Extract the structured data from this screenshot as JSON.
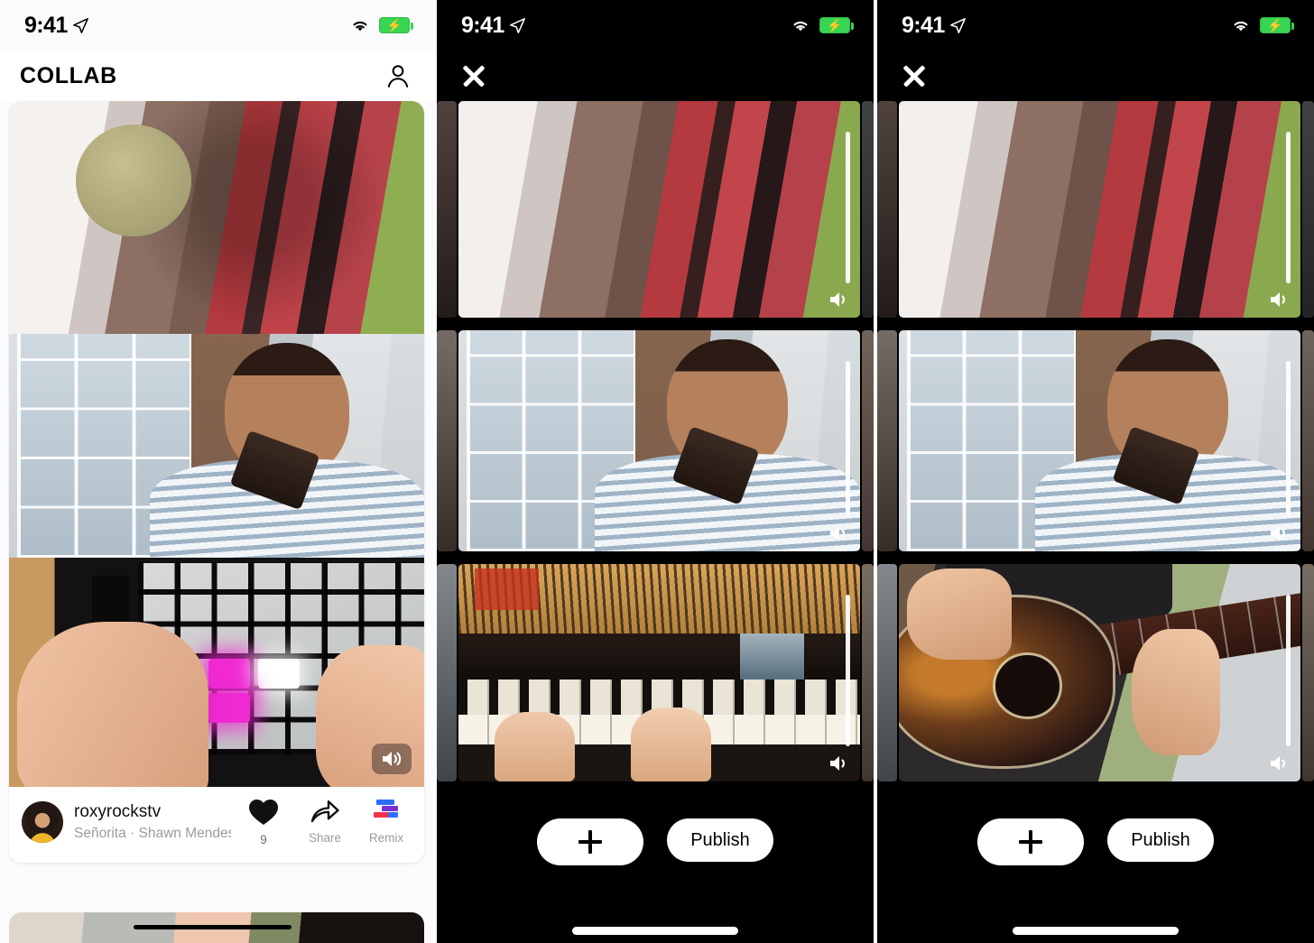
{
  "status_bar": {
    "time": "9:41",
    "location_icon": "location-arrow-icon",
    "wifi_icon": "wifi-icon",
    "battery_icon": "battery-charging-icon",
    "battery_color": "#38d454"
  },
  "panels": [
    {
      "id": "feed",
      "theme": "light",
      "header": {
        "brand": "COLLAB",
        "profile_icon": "person-icon"
      },
      "card": {
        "videos": [
          {
            "name": "tambourine-video",
            "alt": "Bearded man with headphones playing tambourine",
            "muted": false
          },
          {
            "name": "ocarina-video",
            "alt": "Man in striped shirt playing an ocarina",
            "muted": false
          },
          {
            "name": "launchpad-video",
            "alt": "Hands playing a lit-up MIDI drum pad",
            "muted": true
          }
        ],
        "username": "roxyrockstv",
        "track": "Señorita · Shawn Mendes, Camil...",
        "actions": [
          {
            "name": "like-button",
            "icon": "heart-icon",
            "label": "",
            "count": "9"
          },
          {
            "name": "share-button",
            "icon": "share-arrow-icon",
            "label": "Share",
            "count": ""
          },
          {
            "name": "remix-button",
            "icon": "remix-icon",
            "label": "Remix",
            "count": ""
          }
        ]
      },
      "next_card": {
        "name": "next-feed-card",
        "alt": "Partially visible next video card"
      }
    },
    {
      "id": "editor-piano",
      "theme": "dark",
      "close_label": "close-icon",
      "slots": [
        {
          "name": "slot-tambourine",
          "alt": "Bearded man playing tambourine",
          "volume": 72,
          "speaker_icon": "speaker-icon"
        },
        {
          "name": "slot-ocarina",
          "alt": "Man in striped shirt playing an ocarina",
          "volume": 70,
          "speaker_icon": "speaker-icon"
        },
        {
          "name": "slot-piano",
          "alt": "Hands playing a grand piano",
          "volume": 68,
          "speaker_icon": "speaker-icon"
        }
      ],
      "add_button": {
        "name": "add-track-button",
        "icon": "plus-icon",
        "label": "+"
      },
      "publish_button": {
        "name": "publish-button",
        "label": "Publish"
      },
      "home_indicator": "home-indicator"
    },
    {
      "id": "editor-guitar",
      "theme": "dark",
      "close_label": "close-icon",
      "slots": [
        {
          "name": "slot-tambourine",
          "alt": "Bearded man playing tambourine",
          "volume": 72,
          "speaker_icon": "speaker-icon"
        },
        {
          "name": "slot-ocarina",
          "alt": "Man in striped shirt playing an ocarina",
          "volume": 70,
          "speaker_icon": "speaker-icon"
        },
        {
          "name": "slot-guitar",
          "alt": "Person playing an acoustic guitar outdoors",
          "volume": 66,
          "speaker_icon": "speaker-icon"
        }
      ],
      "add_button": {
        "name": "add-track-button",
        "icon": "plus-icon",
        "label": "+"
      },
      "publish_button": {
        "name": "publish-button",
        "label": "Publish"
      },
      "home_indicator": "home-indicator"
    }
  ],
  "colors": {
    "accent_pink": "#f02ad2",
    "battery_green": "#38d454",
    "remix_blue": "#2f6bff",
    "remix_purple": "#7a2fd6",
    "remix_red": "#f0324a",
    "muted_text": "#9a9aa2"
  }
}
